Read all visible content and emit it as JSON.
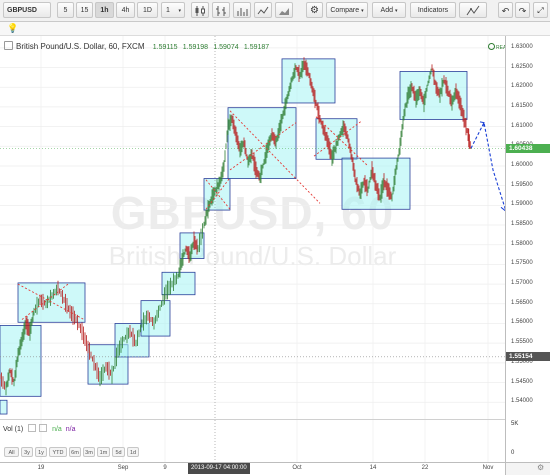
{
  "toolbar": {
    "symbol": "GBPUSD",
    "intervals": [
      "5",
      "15",
      "1h",
      "4h",
      "1D"
    ],
    "interval_active": "1h",
    "multiplier": "1",
    "compare_label": "Compare",
    "add_label": "Add",
    "indicators_label": "Indicators"
  },
  "legend": {
    "title": "British Pound/U.S. Dollar, 60, FXCM",
    "o": "1.59115",
    "h": "1.59198",
    "l": "1.59074",
    "c": "1.59187"
  },
  "realtime_label": "REALTIME",
  "watermark": {
    "line1": "GBPUSD, 60",
    "line2": "British Pound/U.S. Dollar"
  },
  "price_scale": {
    "labels": [
      "1.63000",
      "1.62500",
      "1.62000",
      "1.61500",
      "1.61000",
      "1.60500",
      "1.60000",
      "1.59500",
      "1.59000",
      "1.58500",
      "1.58000",
      "1.57500",
      "1.57000",
      "1.56500",
      "1.56000",
      "1.55500",
      "1.55000",
      "1.54500",
      "1.54000"
    ],
    "current_price": "1.60438",
    "crosshair_price": "1.55154",
    "current_color": "#4caf50",
    "crosshair_color": "#555555"
  },
  "time_axis": {
    "labels": [
      "19",
      "Sep",
      "9",
      "Oct",
      "14",
      "22",
      "Nov"
    ],
    "crosshair_time": "2013-09-17 04:00:00"
  },
  "volume": {
    "label": "Vol (1)",
    "value1": "n/a",
    "value2": "n/a",
    "scale": [
      "5K",
      "0"
    ]
  },
  "range_buttons": [
    "All",
    "3y",
    "1y",
    "YTD",
    "6m",
    "3m",
    "1m",
    "5d",
    "1d"
  ],
  "colors": {
    "up": "#2e7d32",
    "down": "#b71c1c",
    "box_fill": "#a6f4f4",
    "box_stroke": "#2a3f9a",
    "dashed_red": "#e53935",
    "forecast": "#1a3fd6"
  }
}
